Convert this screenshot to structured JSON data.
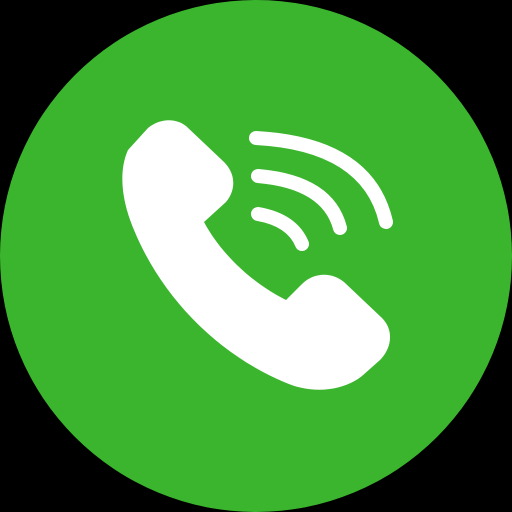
{
  "icon": {
    "name": "phone-call-icon",
    "background_color": "#3BB52E",
    "foreground_color": "#FFFFFF",
    "page_color": "#000000"
  }
}
